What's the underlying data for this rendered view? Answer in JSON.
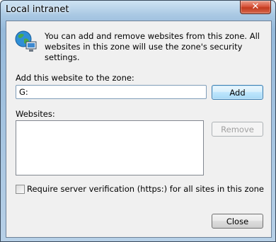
{
  "window": {
    "title": "Local intranet",
    "close_glyph": "✕"
  },
  "info": {
    "icon": "globe-computer-icon",
    "text": "You can add and remove websites from this zone. All websites in this zone will use the zone's security settings."
  },
  "add": {
    "label": "Add this website to the zone:",
    "value": "G:",
    "button_label": "Add"
  },
  "websites": {
    "label": "Websites:",
    "items": [],
    "remove_label": "Remove"
  },
  "verify": {
    "label": "Require server verification (https:) for all sites in this zone",
    "checked": false
  },
  "footer": {
    "close_label": "Close"
  }
}
